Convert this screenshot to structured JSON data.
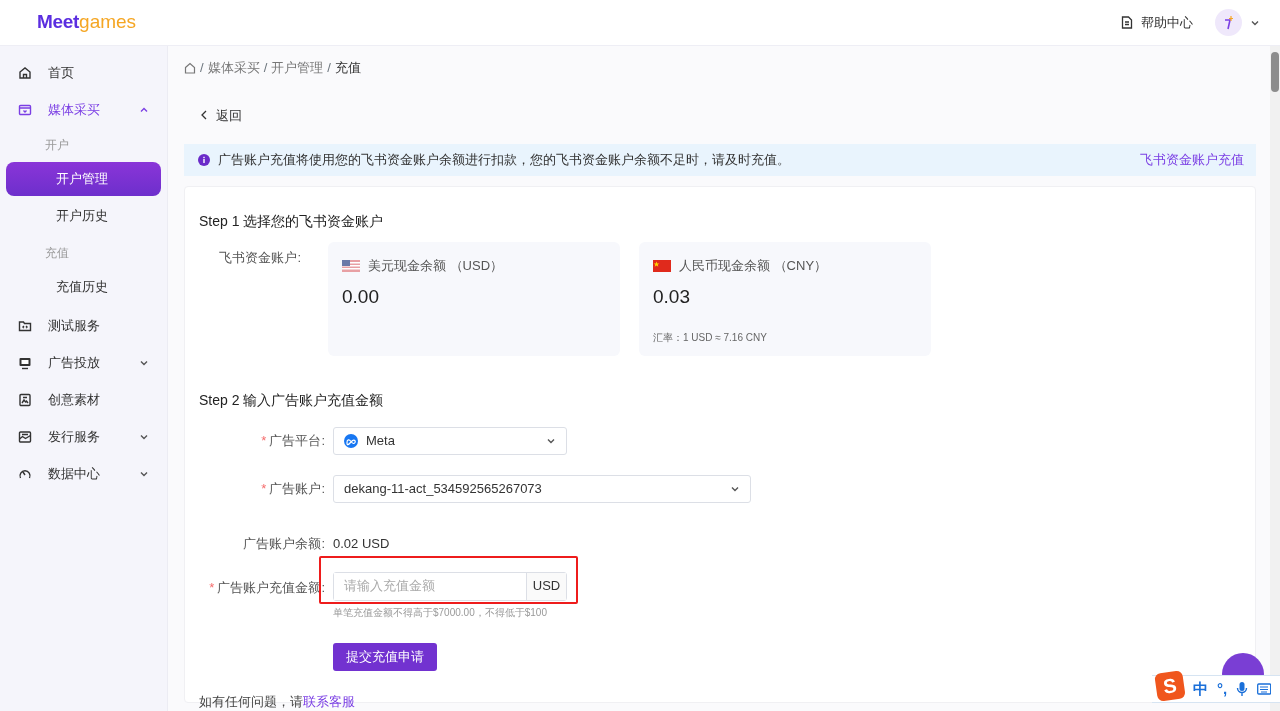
{
  "header": {
    "logo": {
      "primary": "Meet",
      "secondary": "games"
    },
    "help": "帮助中心"
  },
  "sidebar": {
    "items": [
      {
        "label": "首页",
        "selected": false
      },
      {
        "label": "媒体采买",
        "selected": true,
        "expanded": true,
        "children": [
          {
            "kind": "group",
            "label": "开户"
          },
          {
            "kind": "item",
            "label": "开户管理",
            "selected": true
          },
          {
            "kind": "item",
            "label": "开户历史",
            "selected": false
          },
          {
            "kind": "group",
            "label": "充值"
          },
          {
            "kind": "item",
            "label": "充值历史",
            "selected": false
          }
        ]
      },
      {
        "label": "测试服务",
        "selected": false
      },
      {
        "label": "广告投放",
        "selected": false,
        "expanded": false
      },
      {
        "label": "创意素材",
        "selected": false
      },
      {
        "label": "发行服务",
        "selected": false,
        "expanded": false
      },
      {
        "label": "数据中心",
        "selected": false,
        "expanded": false
      }
    ]
  },
  "breadcrumb": {
    "separator": "/",
    "items": [
      "媒体采买",
      "开户管理",
      "充值"
    ]
  },
  "back": "返回",
  "alert": {
    "text": "广告账户充值将使用您的飞书资金账户余额进行扣款，您的飞书资金账户余额不足时，请及时充值。",
    "link": "飞书资金账户充值"
  },
  "step1": {
    "title": "Step 1 选择您的飞书资金账户",
    "label": "飞书资金账户:",
    "accounts": [
      {
        "title": "美元现金余额 （USD）",
        "amount": "0.00"
      },
      {
        "title": "人民币现金余额 （CNY）",
        "amount": "0.03",
        "note": "汇率：1 USD ≈ 7.16 CNY"
      }
    ]
  },
  "step2": {
    "title": "Step 2 输入广告账户充值金额",
    "fields": [
      {
        "kind": "select",
        "label": "广告平台:",
        "mark": "*",
        "value": "Meta",
        "icon": true
      },
      {
        "kind": "select",
        "label": "广告账户:",
        "mark": "*",
        "value": "dekang-11-act_534592565267073",
        "wide": true
      },
      {
        "kind": "text",
        "label": "广告账户余额:",
        "value": "0.02 USD"
      },
      {
        "kind": "amount",
        "label": "广告账户充值金额:",
        "mark": "*",
        "placeholder": "请输入充值金额",
        "addon": "USD",
        "hint": "单笔充值金额不得高于$7000.00，不得低于$100",
        "highlighted": true
      }
    ],
    "submit": "提交充值申请"
  },
  "footer": {
    "text": "如有任何问题，请",
    "link": "联系客服"
  },
  "ime": {
    "logo": "S",
    "mode": "中",
    "punct": "°,"
  }
}
